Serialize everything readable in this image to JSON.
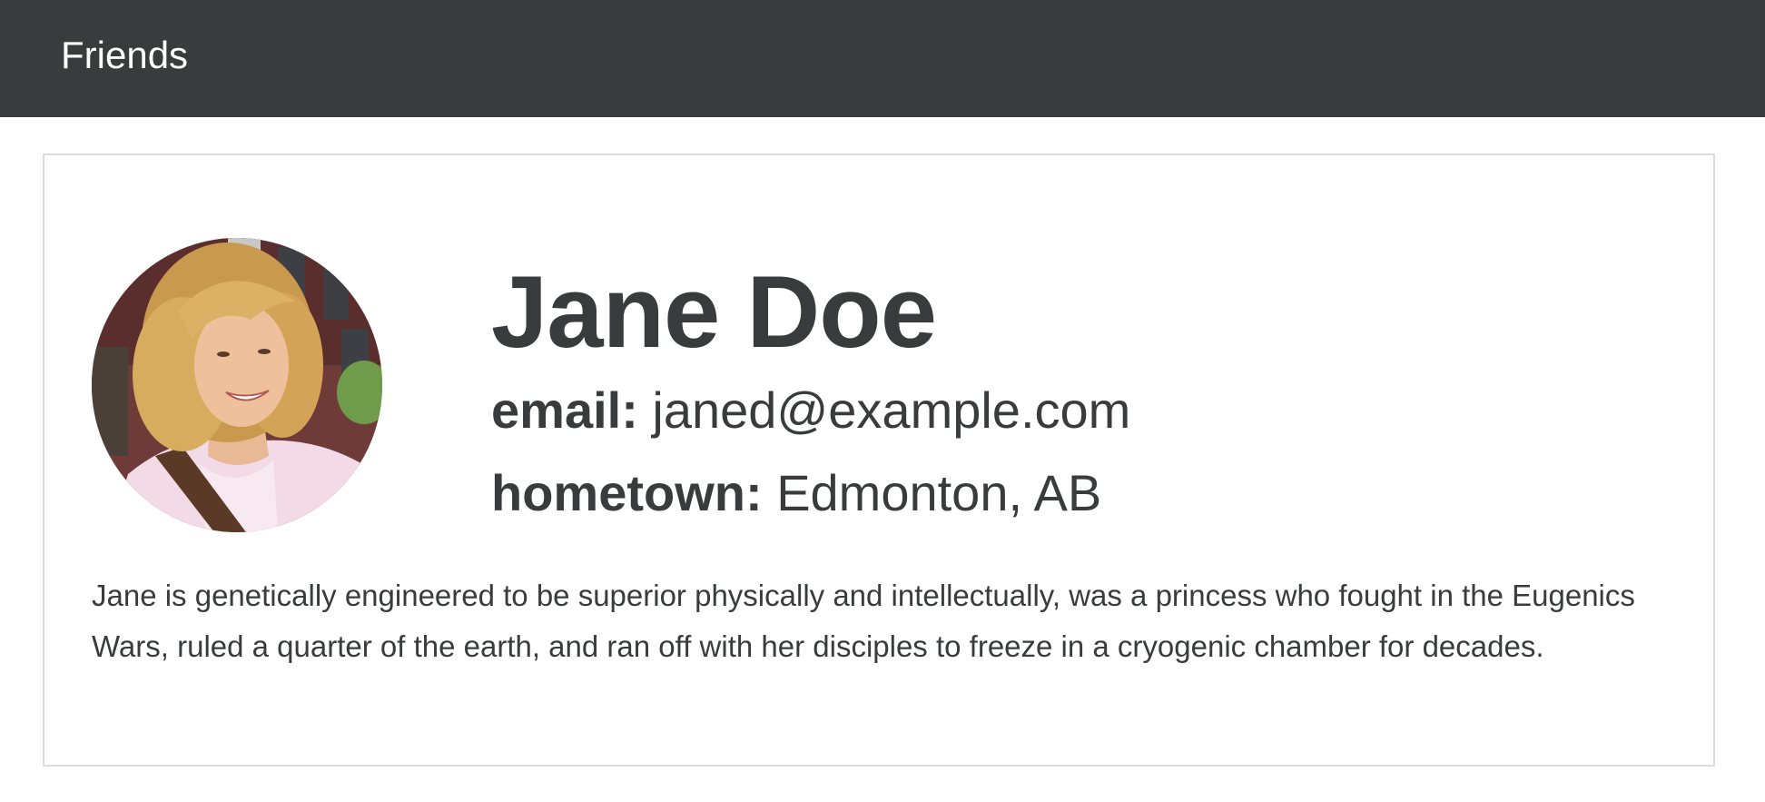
{
  "navbar": {
    "brand": "Friends"
  },
  "profile": {
    "name": "Jane Doe",
    "email_label": "email:",
    "email": "janed@example.com",
    "hometown_label": "hometown:",
    "hometown": "Edmonton, AB",
    "bio": "Jane is genetically engineered to be superior physically and intellectually, was a princess who fought in the Eugenics Wars, ruled a quarter of the earth, and ran off with her disciples to freeze in a cryogenic chamber for decades."
  },
  "colors": {
    "navbar_bg": "#3a3b3d",
    "text": "#3a3b3d",
    "card_border": "#dcdcdc"
  }
}
